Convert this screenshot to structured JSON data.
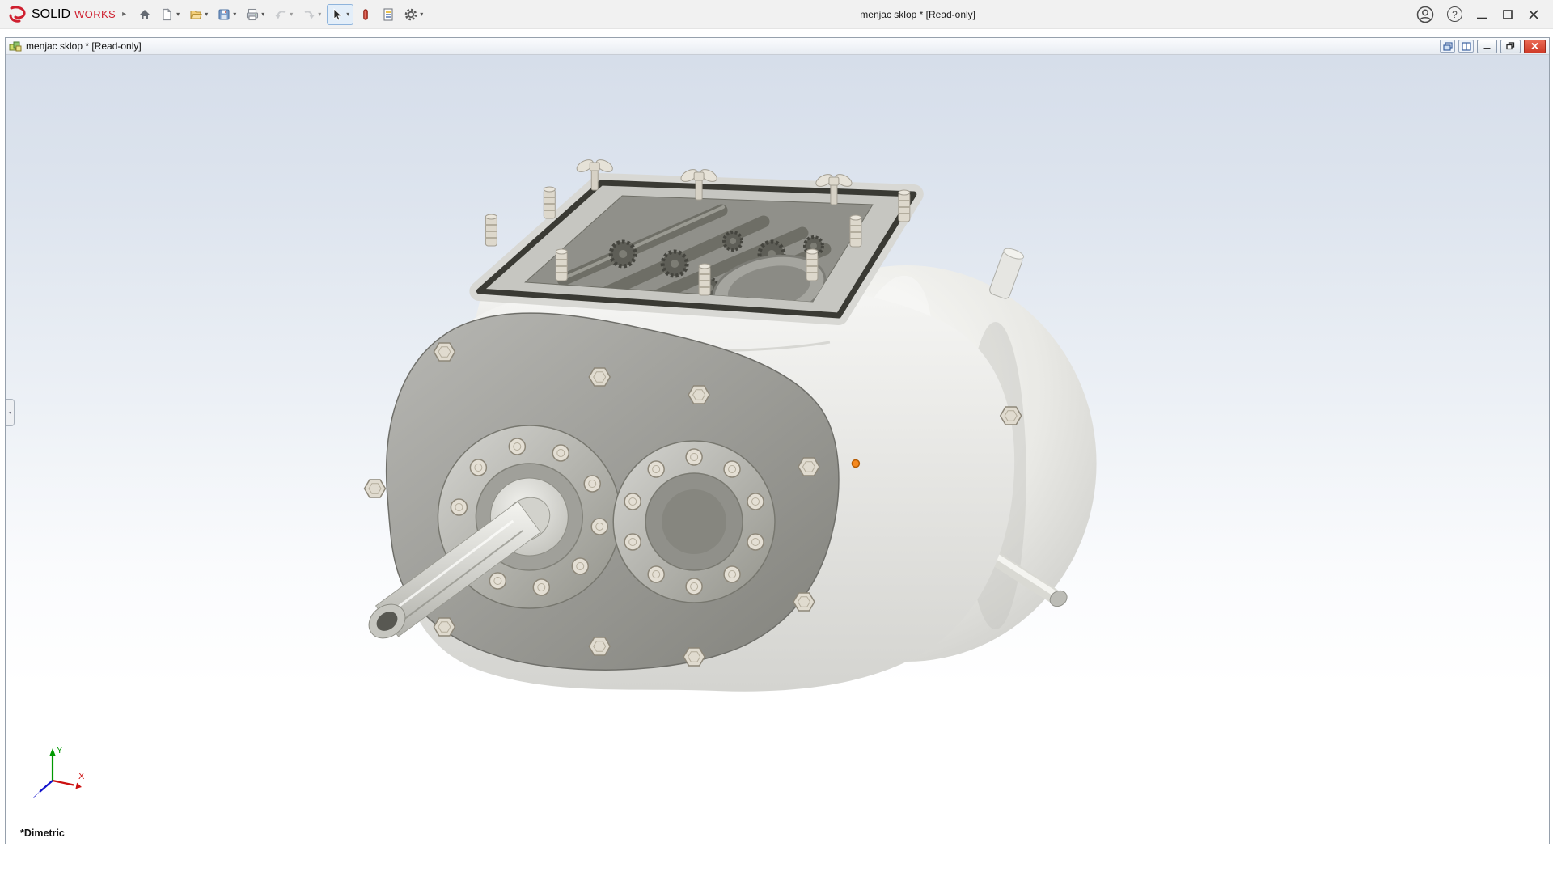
{
  "app": {
    "brand": {
      "solid": "SOLID",
      "works": "WORKS"
    },
    "title": "menjac sklop * [Read-only]"
  },
  "glyphs": {
    "flyout_arrow": "▸",
    "dropdown_arrow": "▾",
    "help": "?",
    "collapse_left": "◂"
  },
  "toolbar": {
    "items": [
      "home",
      "new-document",
      "open",
      "save",
      "print",
      "undo",
      "redo",
      "select",
      "solidworks-resources",
      "file-properties",
      "options"
    ],
    "disabled_items": [
      "undo",
      "redo"
    ],
    "active_item": "select"
  },
  "window_controls": [
    "account",
    "help",
    "minimize",
    "maximize",
    "close"
  ],
  "document_window": {
    "title": "menjac sklop * [Read-only]",
    "controls": [
      "new-window",
      "tile-window",
      "minimize",
      "restore",
      "close"
    ]
  },
  "viewport": {
    "view_orientation": "*Dimetric",
    "triad": {
      "x_label": "X",
      "y_label": "Y"
    }
  },
  "colors": {
    "brand_red": "#cf2030",
    "titlebar_bg": "#f1f1f1",
    "viewport_gradient_top": "#d6deea",
    "viewport_gradient_bottom": "#ffffff",
    "doc_close_red": "#cf3a28",
    "selection_marker_orange": "#f5891f"
  }
}
